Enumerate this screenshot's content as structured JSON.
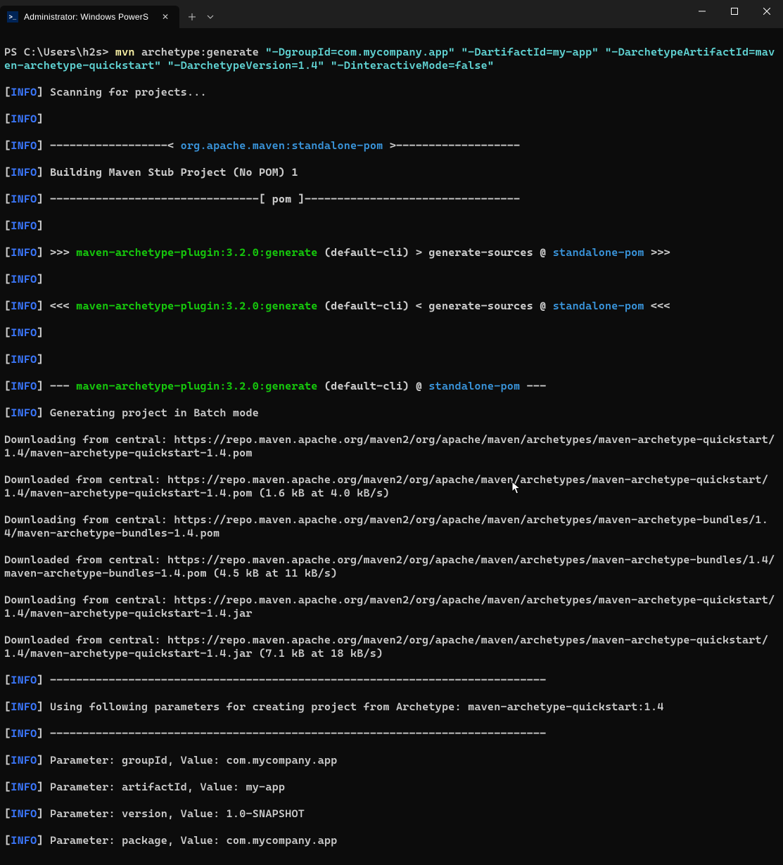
{
  "tab": {
    "title": "Administrator: Windows PowerS"
  },
  "prompt": {
    "path": "PS C:\\Users\\h2s> ",
    "cmd": "mvn",
    "args": " archetype:generate ",
    "lit1": "\"-DgroupId=com.mycompany.app\"",
    "lit2": "\"-DartifactId=my-app\"",
    "lit3": "\"-DarchetypeArtifactId=maven-archetype-quickstart\"",
    "lit4": "\"-DarchetypeVersion=1.4\"",
    "lit5": "\"-DinteractiveMode=false\""
  },
  "info_label": "INFO",
  "texts": {
    "scanning": " Scanning for projects...",
    "dash_left": " ------------------< ",
    "pom_id": "org.apache.maven:standalone-pom",
    "dash_right": " >-------------------",
    "building": " Building Maven Stub Project (No POM) 1",
    "pom_rule": " --------------------------------[ pom ]---------------------------------",
    "rrr_prefix": " >>> ",
    "plugin": "maven-archetype-plugin:3.2.0:generate",
    "rrr_mid": " (default-cli) > generate-sources @ ",
    "standalone": "standalone-pom",
    "rrr_suffix": " >>>",
    "lll_prefix": " <<< ",
    "lll_mid": " (default-cli) < generate-sources @ ",
    "lll_suffix": " <<<",
    "dash3_prefix": " --- ",
    "dash3_mid": " (default-cli) @ ",
    "dash3_suffix": " ---",
    "gen_batch": " Generating project in Batch mode",
    "dl1": "Downloading from central: https://repo.maven.apache.org/maven2/org/apache/maven/archetypes/maven-archetype-quickstart/1.4/maven-archetype-quickstart-1.4.pom",
    "dl2": "Downloaded from central: https://repo.maven.apache.org/maven2/org/apache/maven/archetypes/maven-archetype-quickstart/1.4/maven-archetype-quickstart-1.4.pom (1.6 kB at 4.0 kB/s)",
    "dl3": "Downloading from central: https://repo.maven.apache.org/maven2/org/apache/maven/archetypes/maven-archetype-bundles/1.4/maven-archetype-bundles-1.4.pom",
    "dl4": "Downloaded from central: https://repo.maven.apache.org/maven2/org/apache/maven/archetypes/maven-archetype-bundles/1.4/maven-archetype-bundles-1.4.pom (4.5 kB at 11 kB/s)",
    "dl5": "Downloading from central: https://repo.maven.apache.org/maven2/org/apache/maven/archetypes/maven-archetype-quickstart/1.4/maven-archetype-quickstart-1.4.jar",
    "dl6": "Downloaded from central: https://repo.maven.apache.org/maven2/org/apache/maven/archetypes/maven-archetype-quickstart/1.4/maven-archetype-quickstart-1.4.jar (7.1 kB at 18 kB/s)",
    "rule": " ----------------------------------------------------------------------------",
    "using_params": " Using following parameters for creating project from Archetype: maven-archetype-quickstart:1.4",
    "param_group": " Parameter: groupId, Value: com.mycompany.app",
    "param_artifact": " Parameter: artifactId, Value: my-app",
    "param_version": " Parameter: version, Value: 1.0-SNAPSHOT",
    "param_package": " Parameter: package, Value: com.mycompany.app"
  }
}
